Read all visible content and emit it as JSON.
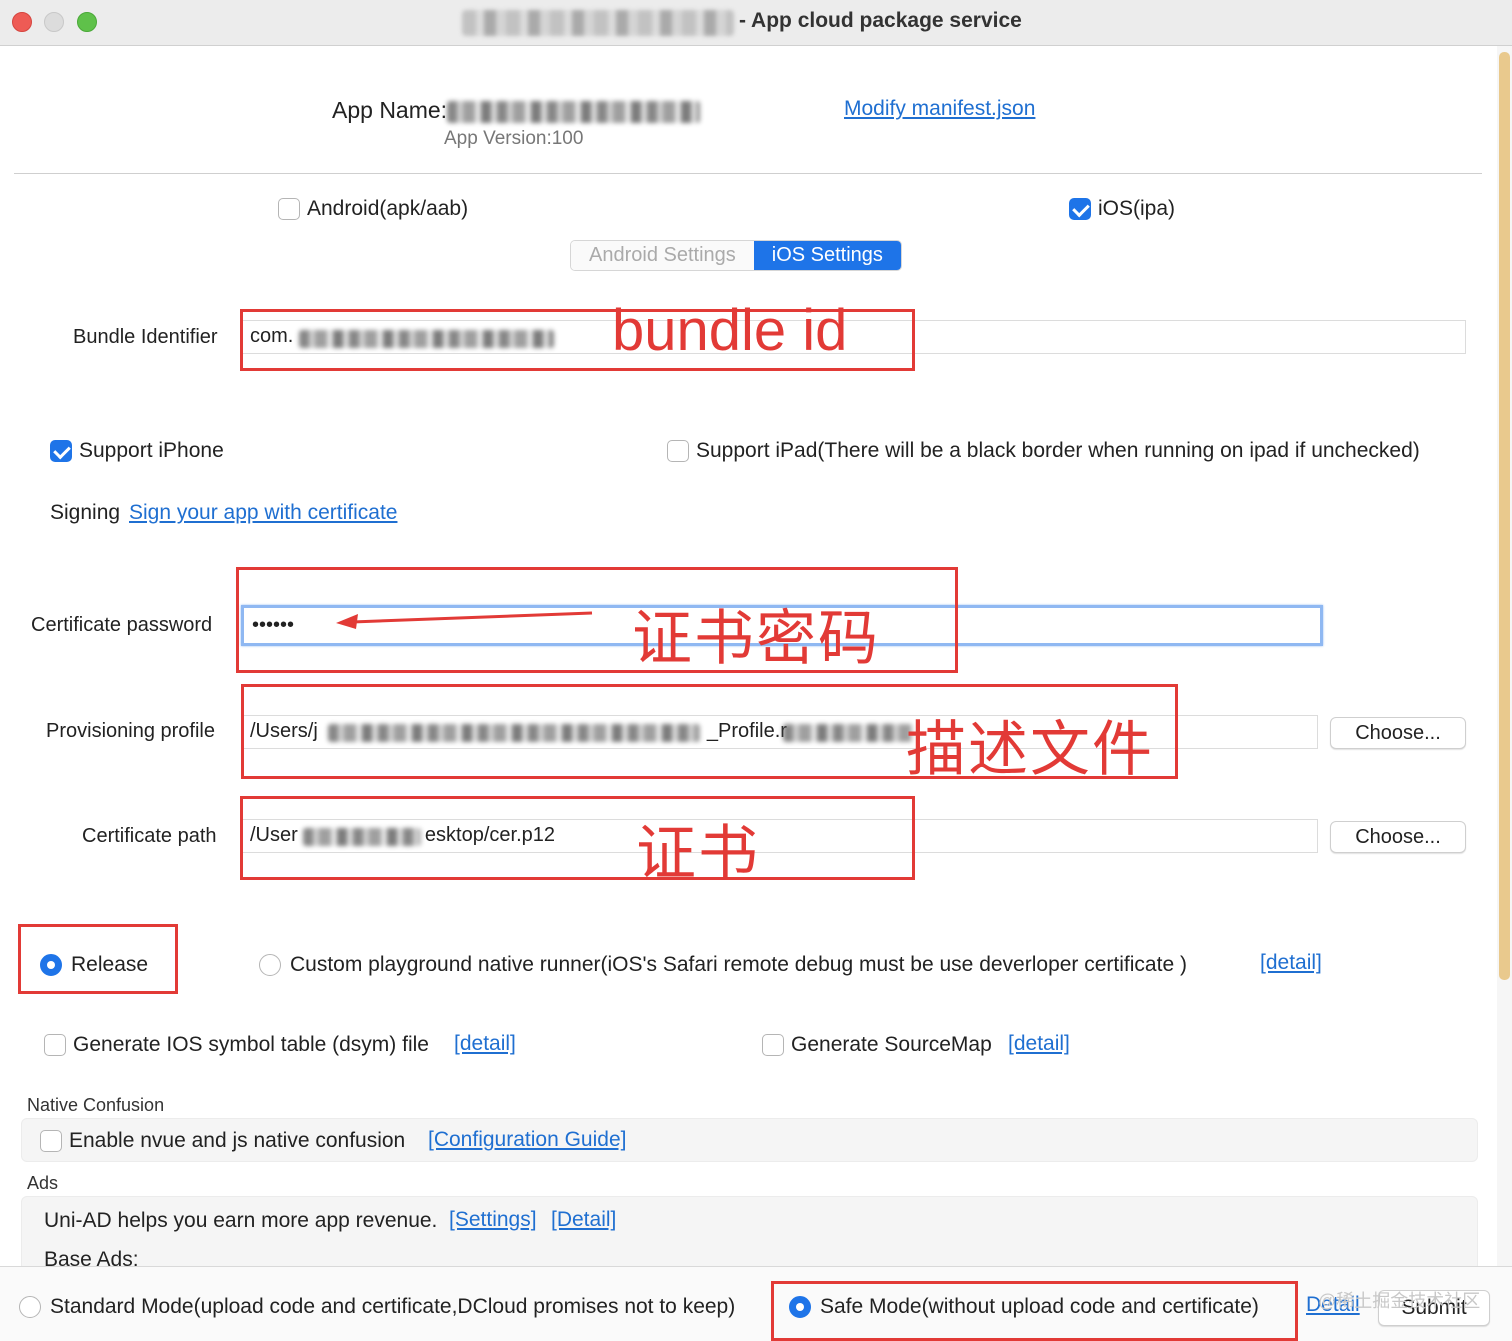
{
  "window": {
    "title": "- App cloud package service"
  },
  "header": {
    "app_name_label": "App Name:",
    "app_version": "App Version:100",
    "modify_link": "Modify manifest.json"
  },
  "platforms": {
    "android": {
      "label": "Android(apk/aab)",
      "checked": false
    },
    "ios": {
      "label": "iOS(ipa)",
      "checked": true
    }
  },
  "tabs": [
    {
      "label": "Android Settings",
      "active": false
    },
    {
      "label": "iOS Settings",
      "active": true
    }
  ],
  "ios_settings": {
    "bundle_identifier": {
      "label": "Bundle Identifier",
      "value": "com."
    },
    "support_iphone": {
      "label": "Support iPhone",
      "checked": true
    },
    "support_ipad": {
      "label": "Support iPad(There will be a black border when running on ipad if unchecked)",
      "checked": false
    },
    "signing": {
      "label": "Signing",
      "link": "Sign your app with certificate"
    },
    "certificate_password": {
      "label": "Certificate password",
      "value": "••••••"
    },
    "provisioning_profile": {
      "label": "Provisioning profile",
      "value_start": "/Users/j",
      "value_mid": "_Profile.r",
      "button": "Choose..."
    },
    "certificate_path": {
      "label": "Certificate path",
      "value_start": "/User",
      "value_end": "esktop/cer.p12",
      "button": "Choose..."
    }
  },
  "annotations": {
    "bundle_id": "bundle id",
    "cert_password": "证书密码",
    "profile": "描述文件",
    "cert": "证书"
  },
  "build_mode": {
    "release": {
      "label": "Release",
      "selected": true
    },
    "custom": {
      "label": "Custom playground native runner(iOS's  Safari remote debug must be use deverloper certificate )",
      "link": "[detail]",
      "selected": false
    }
  },
  "options": {
    "dsym": {
      "label": "Generate IOS symbol table (dsym) file",
      "link": "[detail]",
      "checked": false
    },
    "sourcemap": {
      "label": "Generate SourceMap",
      "link": "[detail]",
      "checked": false
    }
  },
  "native_confusion": {
    "heading": "Native Confusion",
    "label": "Enable nvue and js native confusion",
    "link": "[Configuration Guide]",
    "checked": false
  },
  "ads": {
    "heading": "Ads",
    "text": "Uni-AD helps you earn more app revenue.",
    "settings_link": "[Settings]",
    "detail_link": "[Detail]",
    "base_ads": "Base Ads:"
  },
  "footer": {
    "standard_mode": {
      "label": "Standard Mode(upload code and certificate,DCloud promises not to keep)",
      "selected": false
    },
    "safe_mode": {
      "label": "Safe Mode(without upload code and certificate)",
      "selected": true
    },
    "detail_link": "Detail",
    "submit": "Submit",
    "watermark": "@稀土掘金技术社区"
  },
  "colors": {
    "accent": "#1e74e8",
    "link": "#1f6fd1",
    "annotation_red": "#e23a36"
  }
}
